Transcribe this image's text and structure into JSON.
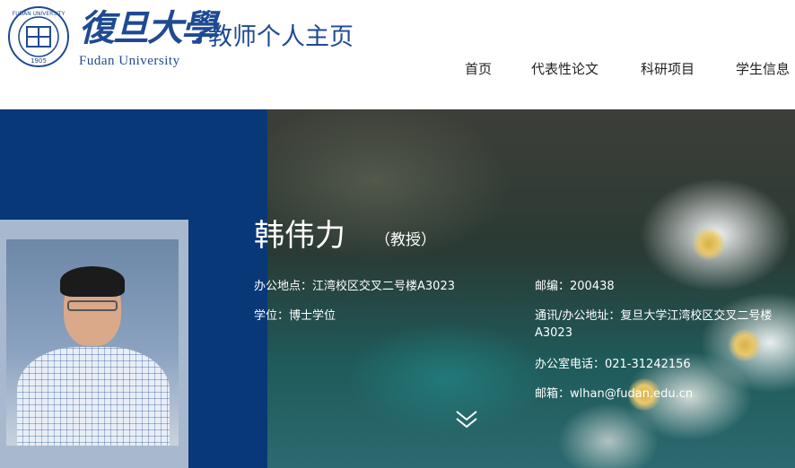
{
  "header": {
    "logo_seal_text": "FUDAN UNIVERSITY 1905",
    "logo_cn": "復旦大學",
    "logo_en": "Fudan University",
    "site_title": "教师个人主页",
    "brand_color": "#1f4a93"
  },
  "nav": {
    "items": [
      {
        "label": "首页"
      },
      {
        "label": "代表性论文"
      },
      {
        "label": "科研项目"
      },
      {
        "label": "学生信息"
      }
    ]
  },
  "profile": {
    "name": "韩伟力",
    "title": "（教授）",
    "office_label": "办公地点：",
    "office_value": "江湾校区交叉二号楼A3023",
    "degree_label": "学位：",
    "degree_value": "博士学位",
    "postcode_label": "邮编：",
    "postcode_value": "200438",
    "address_label": "通讯/办公地址：",
    "address_value": "复旦大学江湾校区交叉二号楼A3023",
    "phone_label": "办公室电话：",
    "phone_value": "021-31242156",
    "email_label": "邮箱：",
    "email_value": "wlhan@fudan.edu.cn"
  },
  "colors": {
    "hero_left": "#083878",
    "photo_frame": "#a8b9cf"
  },
  "icons": {
    "scroll_down": "double-chevron-down-icon"
  }
}
